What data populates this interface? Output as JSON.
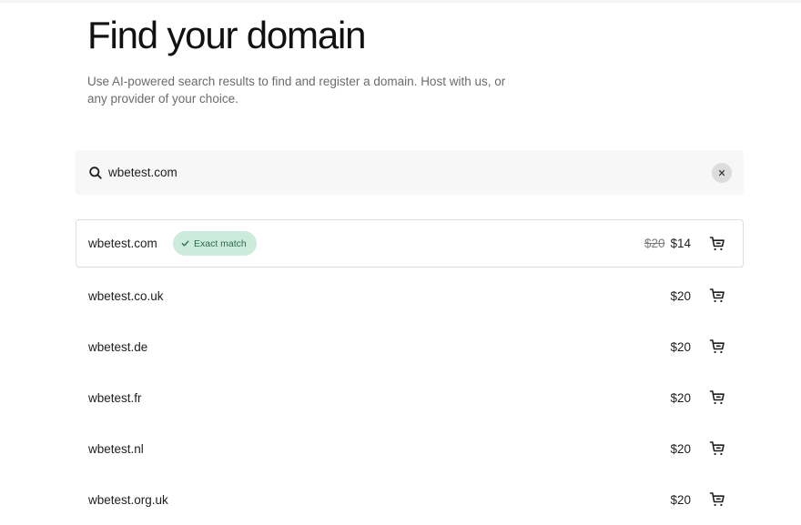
{
  "page": {
    "title": "Find your domain",
    "subtitle_line1": "Use AI-powered search results to find and register a domain. Host with us, or",
    "subtitle_line2": "any provider of your choice."
  },
  "search": {
    "value": "wbetest.com",
    "icon": "search-icon",
    "clear_icon": "close-icon"
  },
  "results": [
    {
      "domain": "wbetest.com",
      "badge": "Exact match",
      "old_price": "$20",
      "price": "$14"
    },
    {
      "domain": "wbetest.co.uk",
      "price": "$20"
    },
    {
      "domain": "wbetest.de",
      "price": "$20"
    },
    {
      "domain": "wbetest.fr",
      "price": "$20"
    },
    {
      "domain": "wbetest.nl",
      "price": "$20"
    },
    {
      "domain": "wbetest.org.uk",
      "price": "$20"
    }
  ],
  "colors": {
    "badge_bg": "#cdebdc",
    "badge_text": "#2a6a4a",
    "search_bg": "#f7f7f7"
  }
}
